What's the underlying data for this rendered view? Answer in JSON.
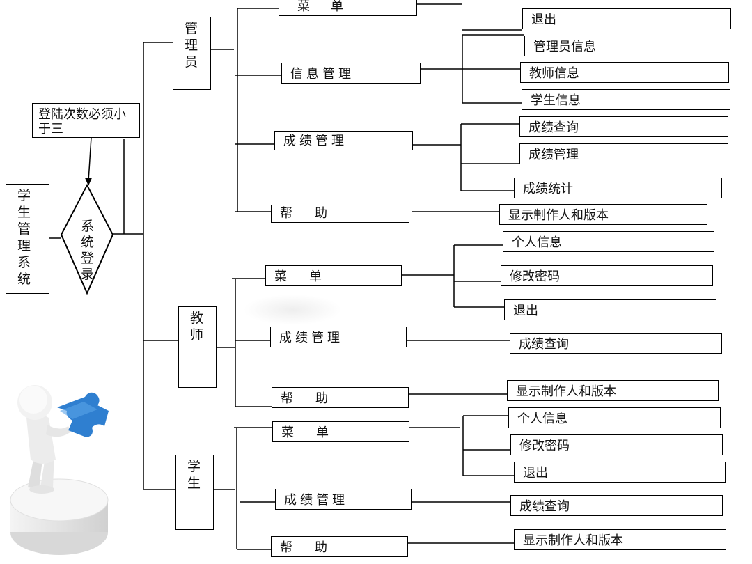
{
  "root": {
    "label": "学生管理系统"
  },
  "login": {
    "label": "系统登录"
  },
  "note": {
    "label": "登陆次数必须小于三"
  },
  "admin": {
    "label": "管理员",
    "menu": {
      "label": "菜　单",
      "children": [
        "退出"
      ]
    },
    "info": {
      "label": "信息管理",
      "children": [
        "管理员信息",
        "教师信息",
        "学生信息"
      ]
    },
    "grades": {
      "label": "成绩管理",
      "children": [
        "成绩查询",
        "成绩管理",
        "成绩统计"
      ]
    },
    "help": {
      "label": "帮　助",
      "children": [
        "显示制作人和版本"
      ]
    }
  },
  "teacher": {
    "label": "教师",
    "menu": {
      "label": "菜　单",
      "children": [
        "个人信息",
        "修改密码",
        "退出"
      ]
    },
    "grades": {
      "label": "成绩管理",
      "children": [
        "成绩查询"
      ]
    },
    "help": {
      "label": "帮　助",
      "children": [
        "显示制作人和版本"
      ]
    }
  },
  "student": {
    "label": "学生",
    "menu": {
      "label": "菜　单",
      "children": [
        "个人信息",
        "修改密码",
        "退出"
      ]
    },
    "grades": {
      "label": "成绩管理",
      "children": [
        "成绩查询"
      ]
    },
    "help": {
      "label": "帮　助",
      "children": [
        "显示制作人和版本"
      ]
    }
  }
}
